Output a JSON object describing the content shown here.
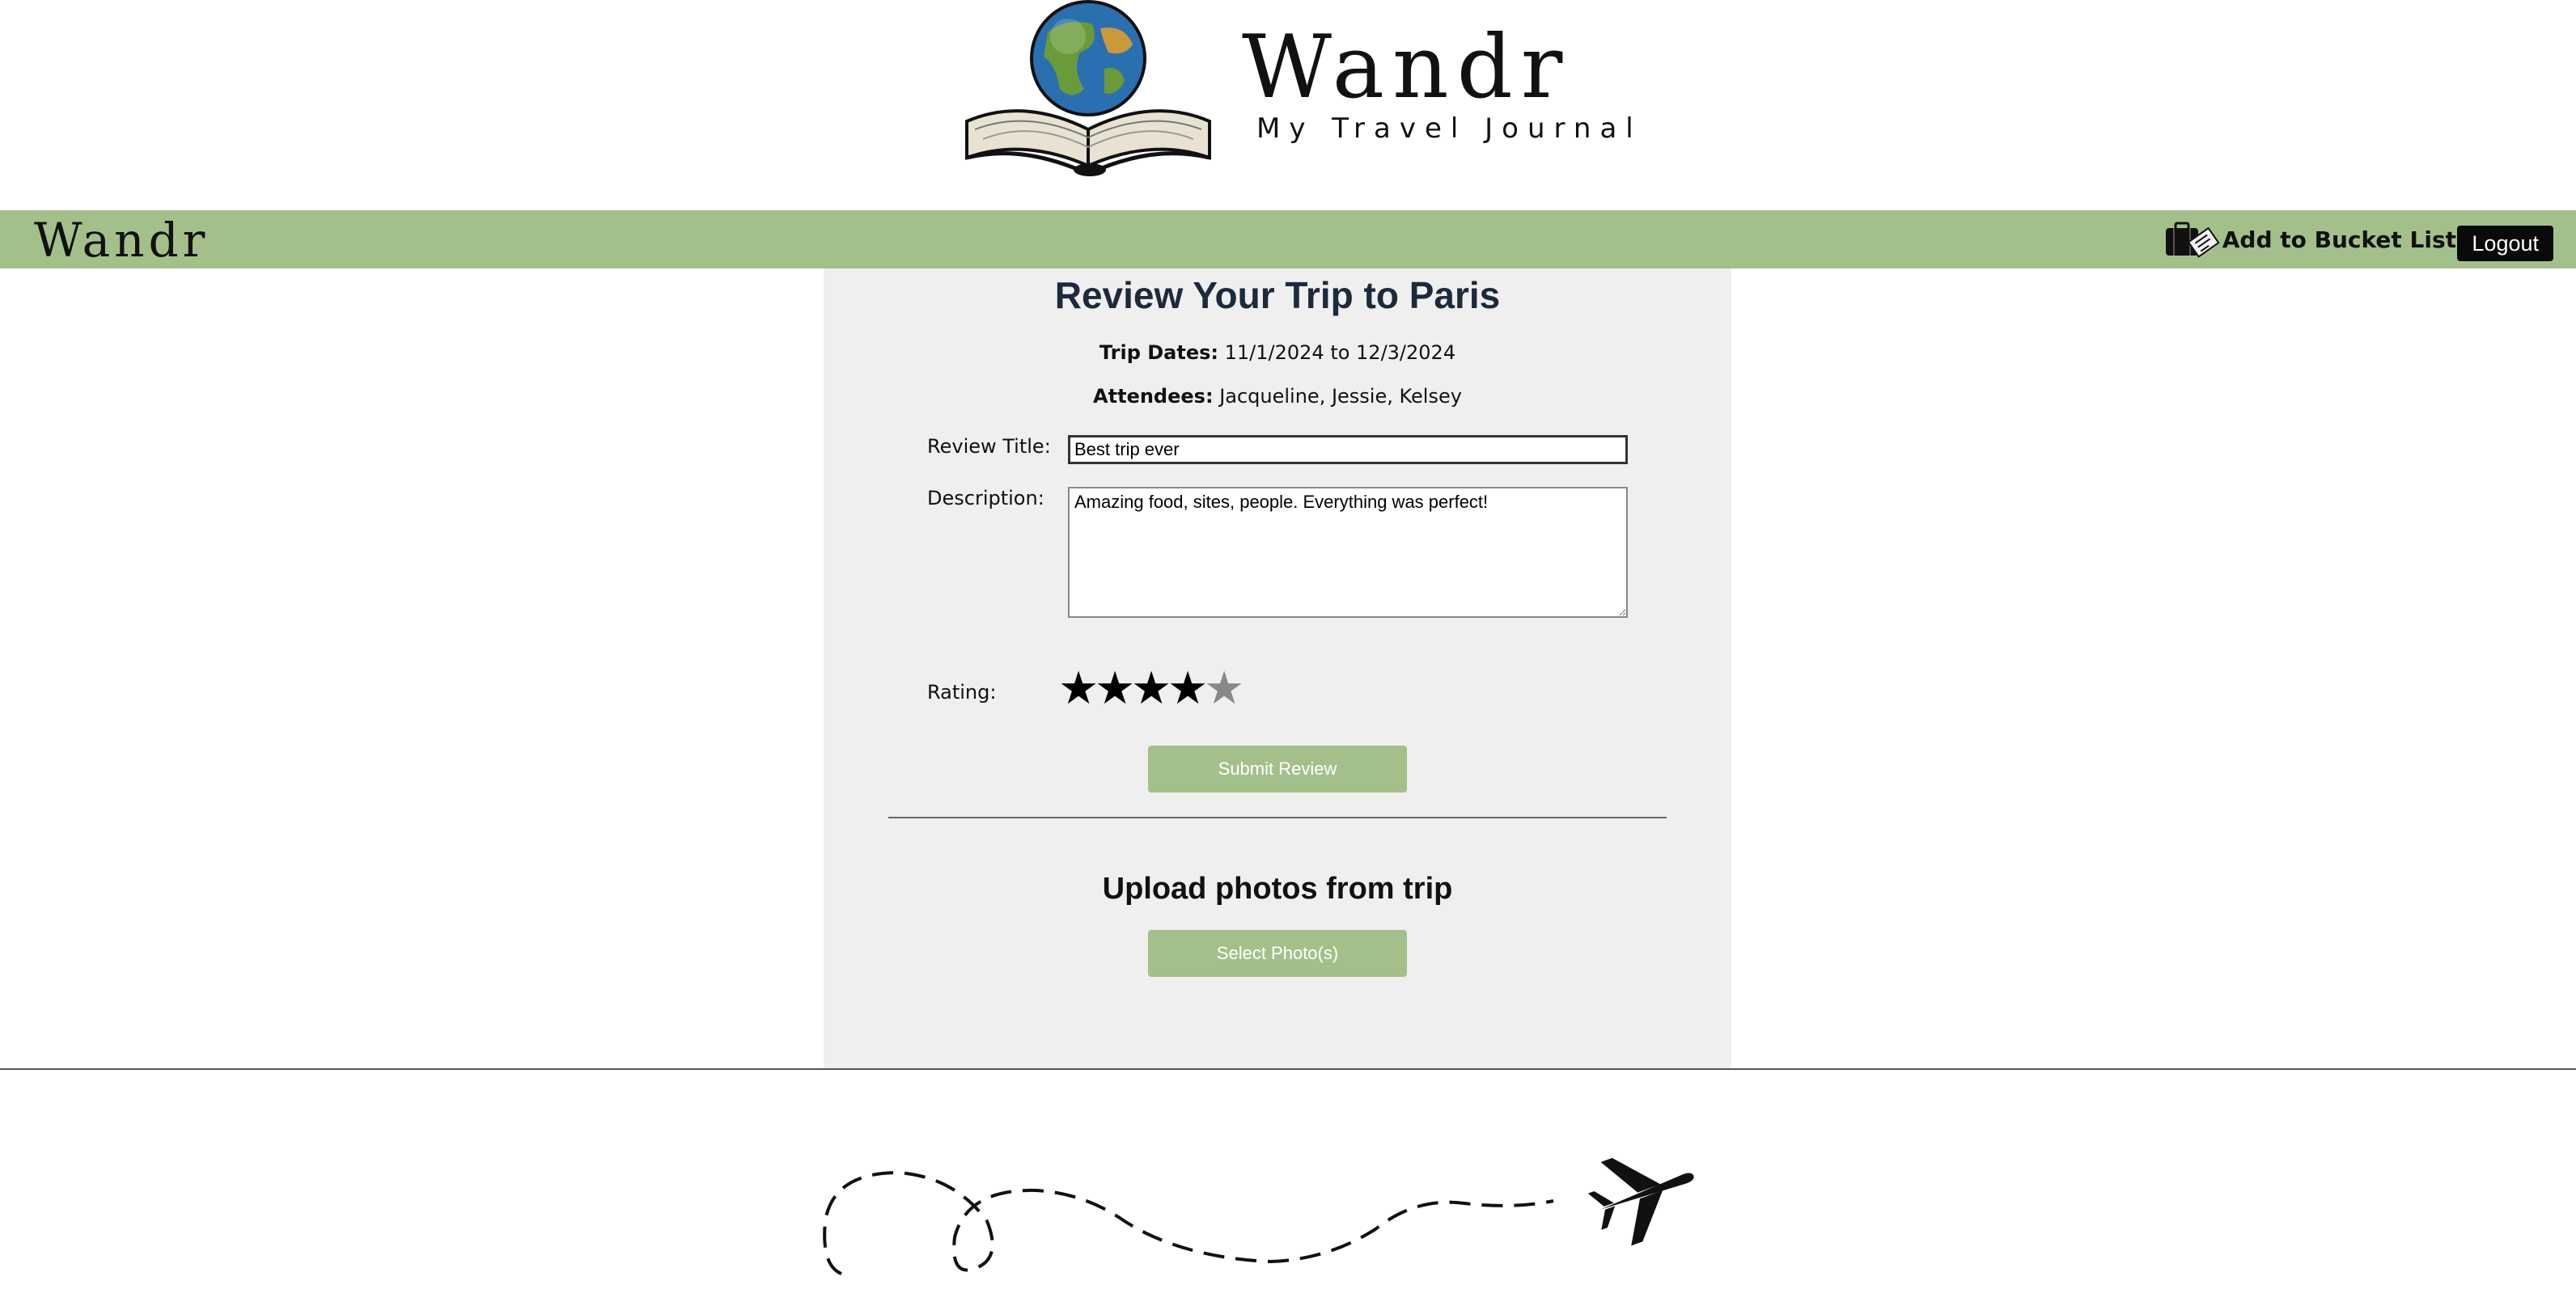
{
  "header": {
    "brand_name": "Wandr",
    "tagline": "My Travel Journal"
  },
  "navbar": {
    "brand": "Wandr",
    "bucket_list_label": "Add to Bucket List",
    "logout_label": "Logout"
  },
  "review": {
    "title": "Review Your Trip to Paris",
    "trip_dates_label": "Trip Dates:",
    "trip_dates_value": "11/1/2024 to 12/3/2024",
    "attendees_label": "Attendees:",
    "attendees_value": "Jacqueline, Jessie, Kelsey",
    "review_title_label": "Review Title:",
    "review_title_value": "Best trip ever",
    "description_label": "Description:",
    "description_value": "Amazing food, sites, people. Everything was perfect!",
    "rating_label": "Rating:",
    "rating": 4,
    "rating_max": 5,
    "submit_label": "Submit Review"
  },
  "upload": {
    "title": "Upload photos from trip",
    "select_label": "Select Photo(s)"
  },
  "colors": {
    "accent_green": "#a3c08b",
    "panel_bg": "#efefef",
    "title_navy": "#1d2a3c",
    "logout_bg": "#0a0a0a"
  },
  "icons": {
    "logo": "globe-on-open-book-icon",
    "bucket": "suitcase-ticket-icon",
    "star": "star-icon",
    "plane": "airplane-icon"
  }
}
